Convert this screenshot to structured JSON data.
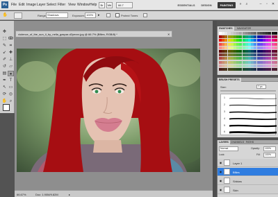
{
  "app": {
    "logo": "Ps",
    "menus": [
      "File",
      "Edit",
      "Image",
      "Layer",
      "Select",
      "Filter",
      "View",
      "Window",
      "Help"
    ],
    "workspaces": [
      "ESSENTIALS",
      "DESIGN",
      "PAINTING"
    ],
    "active_workspace": "PAINTING",
    "zoom_display": "66.7",
    "search_icon": "search-icon"
  },
  "options": {
    "range_label": "Range:",
    "range_value": "Shadows",
    "exposure_label": "Exposure:",
    "exposure_value": "100%",
    "protect_tones": "Protect Tones"
  },
  "document": {
    "tab_title": "violence_of_the_sun_ii_by_nella_gaspar-d2yexxx.jpg @ 66.7% (Bflies, RGB/8) *",
    "zoom": "66.67%",
    "doc_info": "Doc: 1.90M/9.82M"
  },
  "panels": {
    "swatches_tabs": [
      "SWATCHES",
      "NAVIGATOR"
    ],
    "brush_tabs": [
      "BRUSH PRESETS"
    ],
    "brush_size_label": "Size:",
    "brush_size_value": "7 px",
    "brush_sizes": [
      "1",
      "2",
      "3",
      "4",
      "5",
      "6"
    ],
    "layers_tabs": [
      "LAYERS",
      "CHANNELS",
      "PATHS"
    ],
    "blend_mode": "Normal",
    "opacity_label": "Opacity:",
    "opacity_value": "100%",
    "lock_label": "Lock:",
    "fill_label": "Fill:",
    "fill_value": "100%",
    "layers": [
      {
        "name": "Layer 1",
        "selected": false
      },
      {
        "name": "Bflies",
        "selected": true
      },
      {
        "name": "Shbiws",
        "selected": false
      },
      {
        "name": "Skin",
        "selected": false
      }
    ]
  },
  "colors": {
    "accent": "#2f7de0",
    "hair": "#a60e12",
    "skin": "#e5c2b2",
    "lips": "#d47d90",
    "eyes": "#2f8a4e"
  }
}
